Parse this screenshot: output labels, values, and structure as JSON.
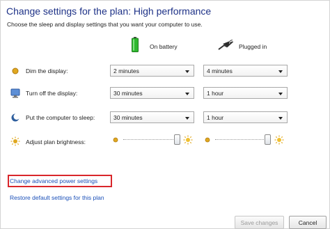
{
  "title": "Change settings for the plan: High performance",
  "subtitle": "Choose the sleep and display settings that you want your computer to use.",
  "columns": {
    "on_battery": "On battery",
    "plugged_in": "Plugged in"
  },
  "rows": [
    {
      "label": "Dim the display:",
      "icon": "dim-display-icon",
      "on_battery": "2 minutes",
      "plugged_in": "4 minutes"
    },
    {
      "label": "Turn off the display:",
      "icon": "monitor-icon",
      "on_battery": "30 minutes",
      "plugged_in": "1 hour"
    },
    {
      "label": "Put the computer to sleep:",
      "icon": "sleep-moon-icon",
      "on_battery": "30 minutes",
      "plugged_in": "1 hour"
    }
  ],
  "brightness": {
    "label": "Adjust plan brightness:",
    "icon": "brightness-sun-icon",
    "on_battery_level": 1.0,
    "plugged_in_level": 1.0
  },
  "links": {
    "advanced": "Change advanced power settings",
    "restore": "Restore default settings for this plan"
  },
  "buttons": {
    "save": "Save changes",
    "cancel": "Cancel"
  },
  "colors": {
    "title": "#1e3287",
    "link": "#1a4fb8",
    "highlight": "#d9262b",
    "battery": "#2eb82e",
    "sun": "#e0a820"
  }
}
